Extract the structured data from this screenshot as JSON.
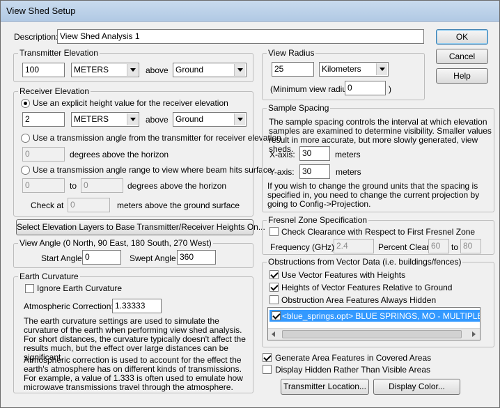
{
  "window": {
    "title": "View Shed Setup"
  },
  "description": {
    "label": "Description:",
    "value": "View Shed Analysis 1"
  },
  "buttons": {
    "ok": "OK",
    "cancel": "Cancel",
    "help": "Help",
    "select_layers": "Select Elevation Layers to Base Transmitter/Receiver Heights On...",
    "transmitter_location": "Transmitter Location...",
    "display_color": "Display Color..."
  },
  "transmitter": {
    "title": "Transmitter Elevation",
    "height": "100",
    "units": "METERS",
    "above_label": "above",
    "reference": "Ground"
  },
  "receiver": {
    "title": "Receiver Elevation",
    "opt_explicit": "Use an explicit height value for the receiver elevation",
    "height": "2",
    "units": "METERS",
    "above_label": "above",
    "reference": "Ground",
    "opt_angle": "Use a transmission angle from the transmitter for receiver elevation",
    "angle_value": "0",
    "angle_suffix": "degrees above the horizon",
    "opt_range": "Use a transmission angle range to view where beam hits surface",
    "range_from": "0",
    "range_to_label": "to",
    "range_to": "0",
    "range_suffix": "degrees above the horizon",
    "check_label": "Check at",
    "check_value": "0",
    "check_suffix": "meters above the ground surface",
    "selected": "explicit"
  },
  "view_angle": {
    "title": "View Angle (0 North, 90 East, 180 South, 270 West)",
    "start_label": "Start Angle",
    "start": "0",
    "swept_label": "Swept Angle",
    "swept": "360"
  },
  "earth": {
    "title": "Earth Curvature",
    "ignore_label": "Ignore Earth Curvature",
    "ignore_checked": false,
    "atmos_label": "Atmospheric Correction:",
    "atmos": "1.33333",
    "para1": "The earth curvature settings are used to simulate the curvature of the earth when performing view shed analysis. For short distances, the curvature typically doesn't affect the results much, but the effect over large distances can be significant.",
    "para2": "Atmospheric correction is used to account for the effect the earth's atmosphere has on different kinds of transmissions. For example, a value of 1.333 is often used to emulate how microwave transmissions travel through the atmosphere."
  },
  "view_radius": {
    "title": "View Radius",
    "value": "25",
    "units": "Kilometers",
    "min_label": "(Minimum view radius:",
    "min_value": "0",
    "min_close": ")"
  },
  "sample_spacing": {
    "title": "Sample Spacing",
    "para1": "The sample spacing controls the interval at which elevation samples are examined to determine visibility. Smaller values result in more accurate, but more slowly generated, view sheds.",
    "x_label": "X-axis:",
    "x_value": "30",
    "x_units": "meters",
    "y_label": "Y-axis:",
    "y_value": "30",
    "y_units": "meters",
    "para2": "If you wish to change the ground units that the spacing is specified in, you need to change the current projection by going to Config->Projection."
  },
  "fresnel": {
    "title": "Fresnel Zone Specification",
    "check_label": "Check Clearance with Respect to First Fresnel Zone",
    "checked": false,
    "freq_label": "Frequency (GHz):",
    "freq": "2.4",
    "pct_label": "Percent Clear:",
    "pct_from": "60",
    "to_label": "to",
    "pct_to": "80"
  },
  "obstructions": {
    "title": "Obstructions from Vector Data (i.e. buildings/fences)",
    "use_vector": "Use Vector Features with Heights",
    "use_vector_checked": true,
    "relative": "Heights of Vector Features Relative to Ground",
    "relative_checked": true,
    "always_hidden": "Obstruction Area Features Always Hidden",
    "always_hidden_checked": false,
    "layers": [
      {
        "label": "<blue_springs.opt> BLUE SPRINGS, MO - MULTIPLE CATE",
        "checked": true
      }
    ]
  },
  "options": {
    "generate_area": "Generate Area Features in Covered Areas",
    "generate_area_checked": true,
    "display_hidden": "Display Hidden Rather Than Visible Areas",
    "display_hidden_checked": false
  }
}
